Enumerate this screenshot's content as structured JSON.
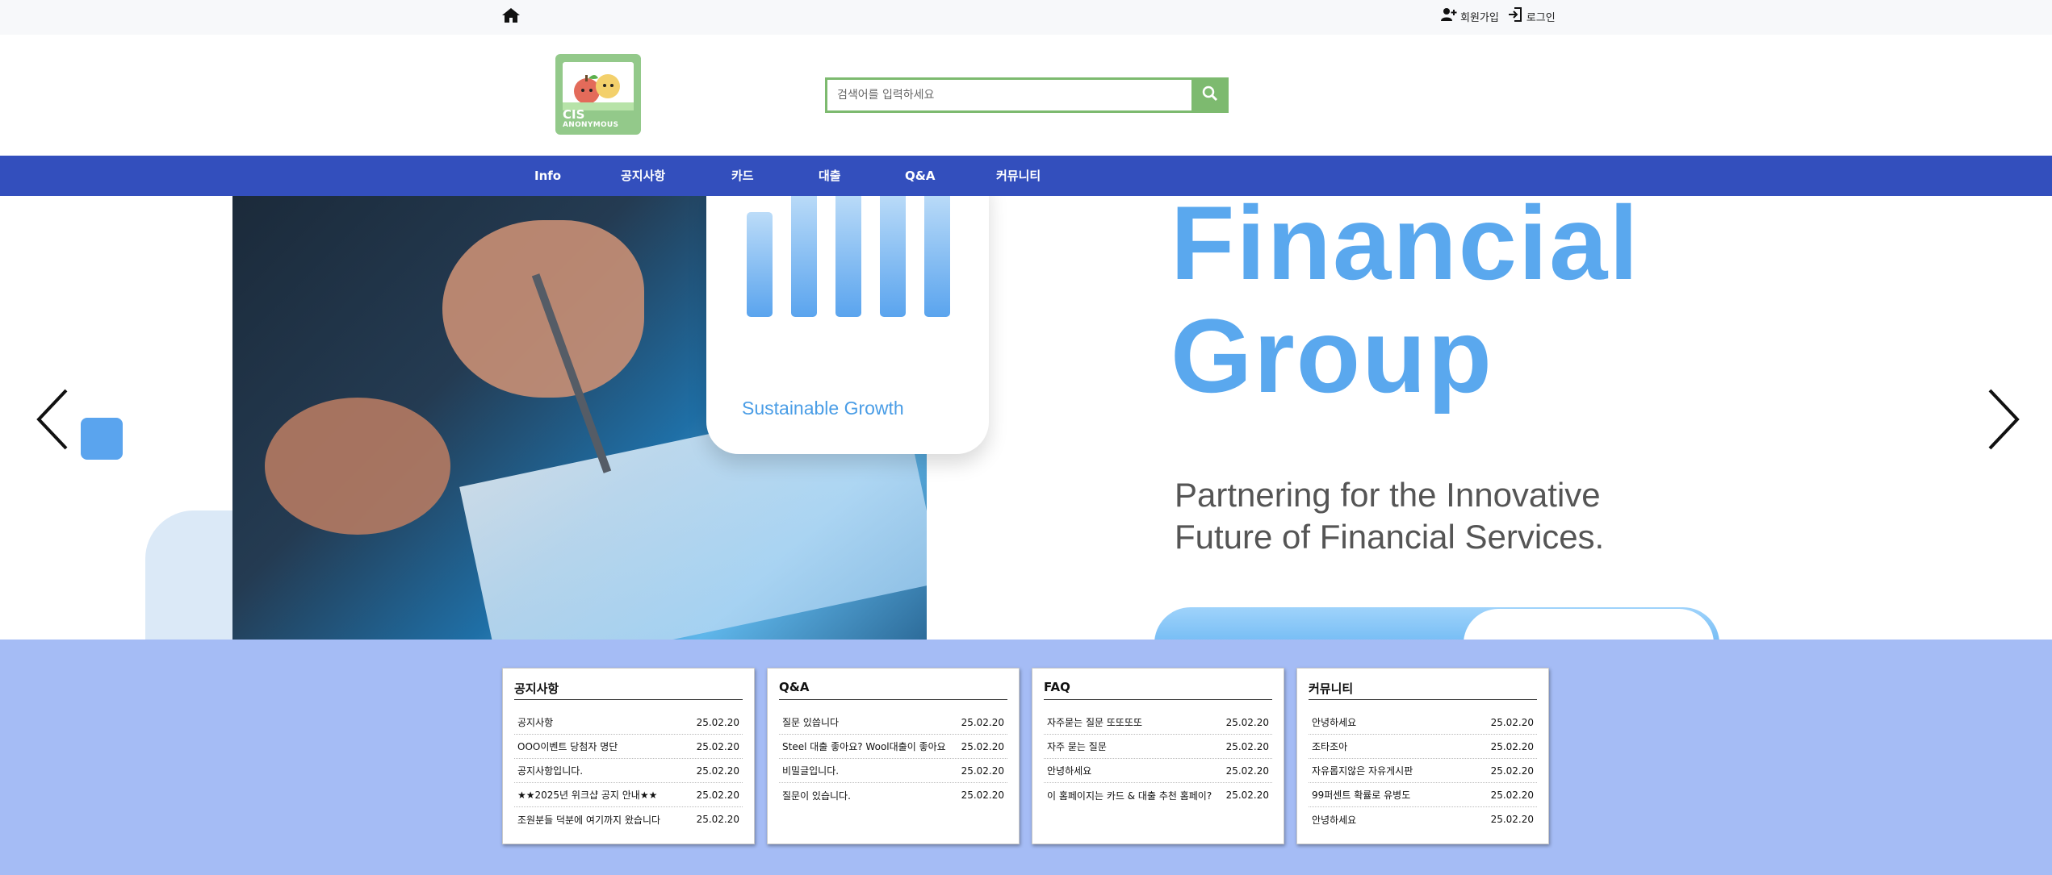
{
  "topbar": {
    "home_icon": "home-icon",
    "signup_label": "회원가입",
    "login_label": "로그인"
  },
  "header": {
    "logo": {
      "line1": "CIS",
      "line2": "ANONYMOUS"
    },
    "search_placeholder": "검색어를 입력하세요",
    "search_icon": "search-icon"
  },
  "nav": {
    "items": [
      {
        "label": "Info"
      },
      {
        "label": "공지사항"
      },
      {
        "label": "카드"
      },
      {
        "label": "대출"
      },
      {
        "label": "Q&A"
      },
      {
        "label": "커뮤니티"
      }
    ]
  },
  "hero": {
    "badge_text": "Sustainable Growth",
    "title_line1": "Financial",
    "title_line2": "Group",
    "subtitle_line1": "Partnering for the Innovative",
    "subtitle_line2": "Future of Financial Services."
  },
  "boards": [
    {
      "title": "공지사항",
      "rows": [
        {
          "title": "공지사항",
          "date": "25.02.20"
        },
        {
          "title": "OOO이벤트 당첨자 명단",
          "date": "25.02.20"
        },
        {
          "title": "공지사항입니다.",
          "date": "25.02.20"
        },
        {
          "title": "★★2025년 위크샵 공지 안내★★",
          "date": "25.02.20"
        },
        {
          "title": "조원분들 덕분에 여기까지 왔습니다",
          "date": "25.02.20"
        }
      ]
    },
    {
      "title": "Q&A",
      "rows": [
        {
          "title": "질문 있씁니다",
          "date": "25.02.20"
        },
        {
          "title": "Steel 대출 좋아요? Wool대출이 좋아요",
          "date": "25.02.20"
        },
        {
          "title": "비밀글입니다.",
          "date": "25.02.20"
        },
        {
          "title": "질문이 있습니다.",
          "date": "25.02.20"
        }
      ]
    },
    {
      "title": "FAQ",
      "rows": [
        {
          "title": "자주묻는 질문 또또또또",
          "date": "25.02.20"
        },
        {
          "title": "자주 묻는 질문",
          "date": "25.02.20"
        },
        {
          "title": "안녕하세요",
          "date": "25.02.20"
        },
        {
          "title": "이 홈페이지는 카드 & 대출 추천 홈페이?",
          "date": "25.02.20"
        }
      ]
    },
    {
      "title": "커뮤니티",
      "rows": [
        {
          "title": "안녕하세요",
          "date": "25.02.20"
        },
        {
          "title": "조타조아",
          "date": "25.02.20"
        },
        {
          "title": "자유롭지않은 자유게시판",
          "date": "25.02.20"
        },
        {
          "title": "99퍼센트 확률로 유병도",
          "date": "25.02.20"
        },
        {
          "title": "안녕하세요",
          "date": "25.02.20"
        }
      ]
    }
  ]
}
